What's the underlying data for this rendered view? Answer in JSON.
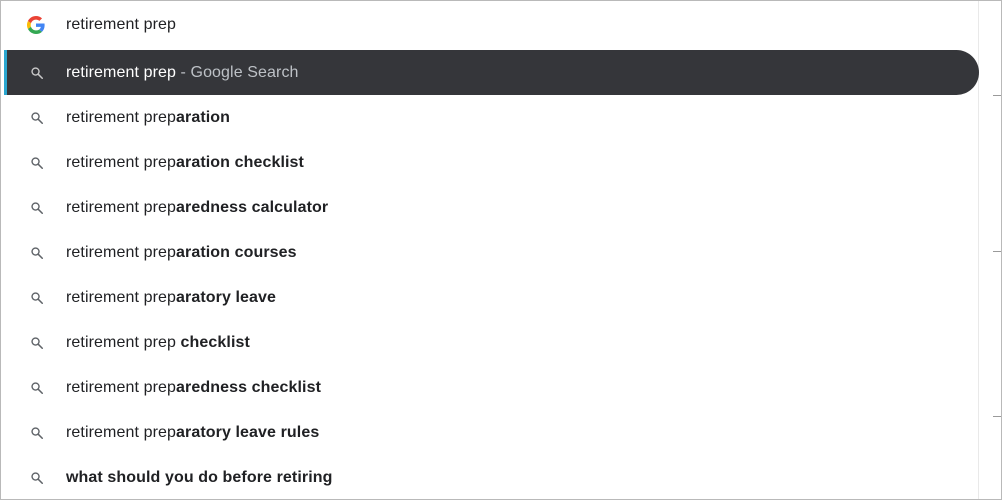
{
  "omnibox": {
    "query": "retirement prep",
    "engine_icon": "google-g-icon"
  },
  "selected": {
    "query": "retirement prep",
    "suffix": " - Google Search"
  },
  "suggestions": [
    {
      "prefix": "retirement prep",
      "completion": "aration"
    },
    {
      "prefix": "retirement prep",
      "completion": "aration checklist"
    },
    {
      "prefix": "retirement prep",
      "completion": "aredness calculator"
    },
    {
      "prefix": "retirement prep",
      "completion": "aration courses"
    },
    {
      "prefix": "retirement prep",
      "completion": "aratory leave"
    },
    {
      "prefix": "retirement prep ",
      "completion": "checklist"
    },
    {
      "prefix": "retirement prep",
      "completion": "aredness checklist"
    },
    {
      "prefix": "retirement prep",
      "completion": "aratory leave rules"
    },
    {
      "prefix": "",
      "completion": "what should you do before retiring"
    }
  ],
  "colors": {
    "selected_bg": "#35363a",
    "selected_accent": "#2aa6cf",
    "text": "#202124",
    "muted": "#bdc1c6"
  }
}
